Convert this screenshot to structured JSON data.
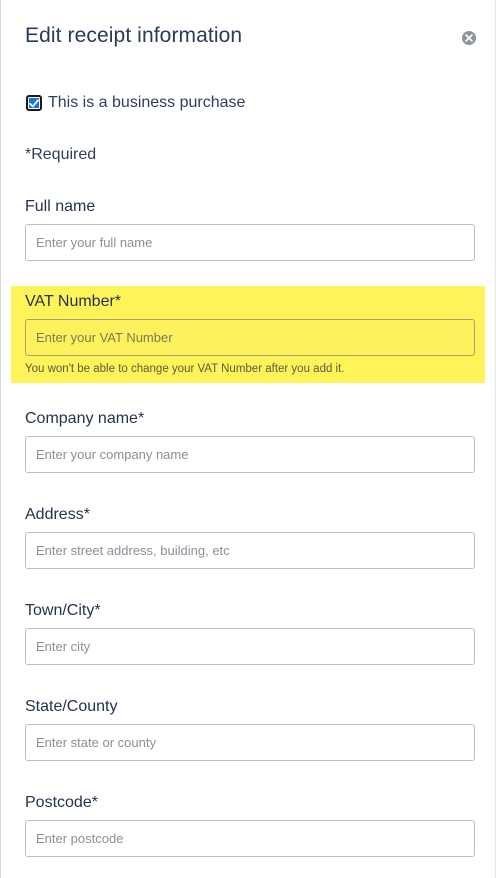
{
  "title": "Edit receipt information",
  "close_icon": "close-icon",
  "business": {
    "checked": true,
    "label": "This is a business purchase"
  },
  "required_note": "*Required",
  "fields": {
    "full_name": {
      "label": "Full name",
      "placeholder": "Enter your full name",
      "value": ""
    },
    "vat": {
      "label": "VAT Number*",
      "placeholder": "Enter your VAT Number",
      "value": "",
      "help": "You won't be able to change your VAT Number after you add it."
    },
    "company": {
      "label": "Company name*",
      "placeholder": "Enter your company name",
      "value": ""
    },
    "address": {
      "label": "Address*",
      "placeholder": "Enter street address, building, etc",
      "value": ""
    },
    "town": {
      "label": "Town/City*",
      "placeholder": "Enter city",
      "value": ""
    },
    "state": {
      "label": "State/County",
      "placeholder": "Enter state or county",
      "value": ""
    },
    "postcode": {
      "label": "Postcode*",
      "placeholder": "Enter postcode",
      "value": ""
    }
  },
  "colors": {
    "highlight": "#fef45a",
    "text": "#25324f",
    "checkbox_fill": "#1a73e8"
  }
}
